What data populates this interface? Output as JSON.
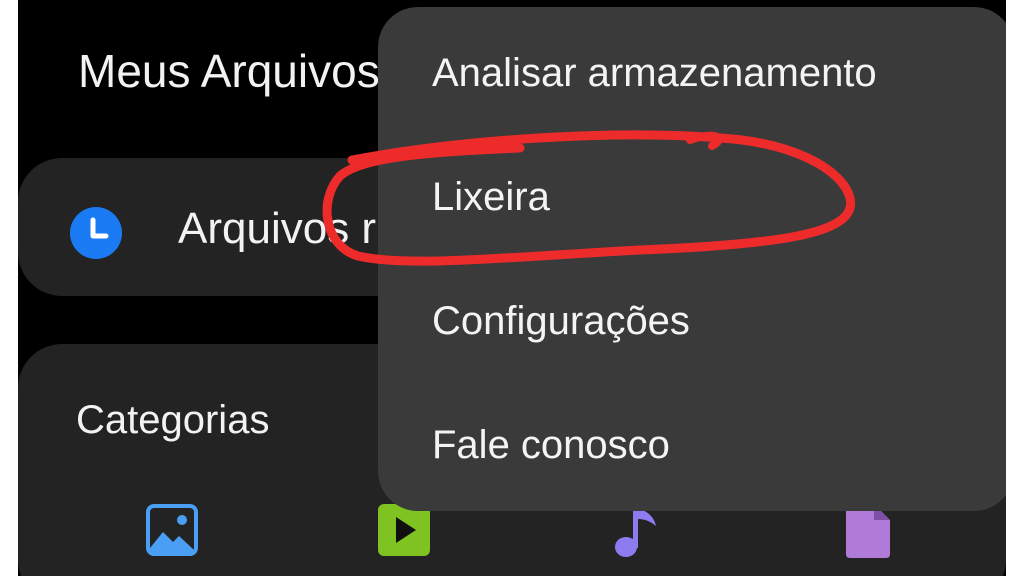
{
  "app": {
    "title": "Meus Arquivos"
  },
  "recent": {
    "label": "Arquivos recentes",
    "icon": "clock-icon",
    "icon_color": "#1a7bf5"
  },
  "categories": {
    "title": "Categorias",
    "items": [
      {
        "icon": "image-icon",
        "color": "#4a9ff5"
      },
      {
        "icon": "video-play-icon",
        "color": "#7ec322"
      },
      {
        "icon": "music-note-icon",
        "color": "#8c7cf0"
      },
      {
        "icon": "document-icon",
        "color": "#b07ad9"
      }
    ]
  },
  "menu": {
    "items": [
      {
        "label": "Analisar armazenamento"
      },
      {
        "label": "Lixeira"
      },
      {
        "label": "Configurações"
      },
      {
        "label": "Fale conosco"
      }
    ]
  },
  "annotation": {
    "target": "Lixeira",
    "color": "#ee2b2b"
  },
  "colors": {
    "background": "#000000",
    "card": "#232323",
    "menu": "#3a3a3a",
    "text": "#f2f2f2"
  }
}
